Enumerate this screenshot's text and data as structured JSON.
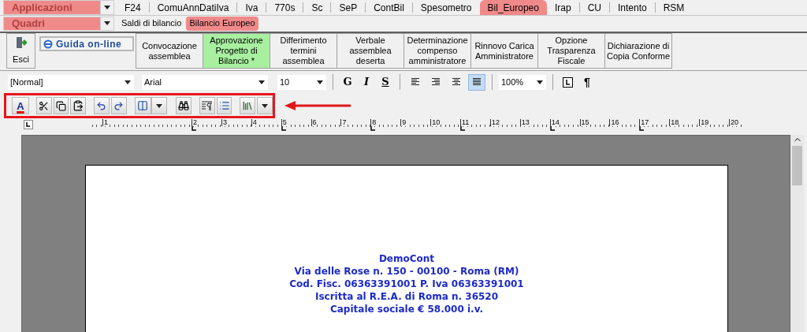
{
  "selectors": [
    {
      "label": "Applicazioni"
    },
    {
      "label": "Quadri"
    }
  ],
  "app_tabs": [
    {
      "label": "F24",
      "selected": false
    },
    {
      "label": "ComuAnnDatiIva",
      "selected": false
    },
    {
      "label": "Iva",
      "selected": false
    },
    {
      "label": "770s",
      "selected": false
    },
    {
      "label": "Sc",
      "selected": false
    },
    {
      "label": "SeP",
      "selected": false
    },
    {
      "label": "ContBil",
      "selected": false
    },
    {
      "label": "Spesometro",
      "selected": false
    },
    {
      "label": "Bil_Europeo",
      "selected": true
    },
    {
      "label": "Irap",
      "selected": false
    },
    {
      "label": "CU",
      "selected": false
    },
    {
      "label": "Intento",
      "selected": false
    },
    {
      "label": "RSM",
      "selected": false
    }
  ],
  "quadri_tabs": [
    {
      "label": "Saldi di bilancio",
      "selected": false
    },
    {
      "label": "Bilancio Europeo",
      "selected": true
    }
  ],
  "exit_button": "Esci",
  "help_button": "Guida on-line",
  "sections": [
    {
      "label": "Convocazione\nassemblea",
      "selected": false
    },
    {
      "label": "Approvazione\nProgetto di\nBilancio *",
      "selected": true
    },
    {
      "label": "Differimento\ntermini\nassemblea",
      "selected": false
    },
    {
      "label": "Verbale\nassemblea\ndeserta",
      "selected": false
    },
    {
      "label": "Determinazione\ncompenso\namministratore",
      "selected": false
    },
    {
      "label": "Rinnovo Carica\nAmministratore",
      "selected": false
    },
    {
      "label": "Opzione\nTrasparenza\nFiscale",
      "selected": false
    },
    {
      "label": "Dichiarazione di\nCopia Conforme",
      "selected": false
    }
  ],
  "format_bar": {
    "style": "[Normal]",
    "font": "Arial",
    "size": "10",
    "zoom": "100%",
    "pilcrow": "¶",
    "text_buttons": [
      {
        "label": "G",
        "kind": "bold"
      },
      {
        "label": "I",
        "kind": "italic"
      },
      {
        "label": "S",
        "kind": "underline"
      }
    ],
    "alignments": [
      {
        "kind": "left",
        "selected": false
      },
      {
        "kind": "right",
        "selected": false
      },
      {
        "kind": "center",
        "selected": false
      },
      {
        "kind": "justify",
        "selected": true
      }
    ]
  },
  "edit_bar": {
    "font_color_label": "A"
  },
  "ruler": {
    "numbers": [
      "1",
      "2",
      "3",
      "4",
      "5",
      "6",
      "7",
      "8",
      "9",
      "10",
      "11",
      "12",
      "13",
      "14",
      "15",
      "16",
      "17",
      "18",
      "19",
      "20"
    ]
  },
  "document": {
    "lines": [
      "DemoCont",
      "Via delle Rose n. 150 - 00100 - Roma (RM)",
      "Cod. Fisc. 06363391001 P. Iva 06363391001",
      "Iscritta al R.E.A. di Roma n. 36520",
      "Capitale sociale € 58.000 i.v."
    ]
  }
}
